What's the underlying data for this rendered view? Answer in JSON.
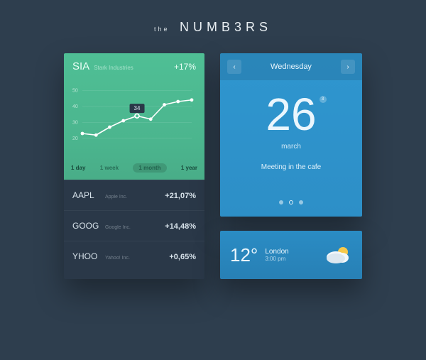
{
  "title": {
    "prefix": "the",
    "word": "NUMB3RS"
  },
  "stock": {
    "featured": {
      "ticker": "SIA",
      "company": "Stark Industries",
      "change": "+17%",
      "callout": "34"
    },
    "ranges": [
      {
        "label": "1 day",
        "selected": false,
        "bold": true
      },
      {
        "label": "1 week",
        "selected": false,
        "bold": false
      },
      {
        "label": "1 month",
        "selected": true,
        "bold": false
      },
      {
        "label": "1 year",
        "selected": false,
        "bold": true
      }
    ],
    "rows": [
      {
        "ticker": "AAPL",
        "company": "Apple Inc.",
        "change": "+21,07%"
      },
      {
        "ticker": "GOOG",
        "company": "Google Inc.",
        "change": "+14,48%"
      },
      {
        "ticker": "YHOO",
        "company": "Yahoo! Inc.",
        "change": "+0,65%"
      }
    ]
  },
  "chart_data": {
    "type": "line",
    "x": [
      0,
      1,
      2,
      3,
      4,
      5,
      6,
      7,
      8
    ],
    "values": [
      23,
      22,
      27,
      31,
      34,
      32,
      41,
      43,
      44
    ],
    "ylabels": [
      "50",
      "40",
      "30",
      "20"
    ],
    "ylim": [
      15,
      55
    ],
    "highlight_index": 4
  },
  "calendar": {
    "weekday": "Wednesday",
    "day": "26",
    "month": "march",
    "event": "Meeting in the cafe",
    "notifications": "3",
    "pages": 3,
    "active_page": 1
  },
  "weather": {
    "temp": "12°",
    "city": "London",
    "time": "3:00 pm",
    "condition": "partly-cloudy"
  },
  "colors": {
    "bg": "#2e3e4e",
    "stock_green": "#4fbf95",
    "card_dark": "#2a3848",
    "blue": "#2d8fc7"
  }
}
